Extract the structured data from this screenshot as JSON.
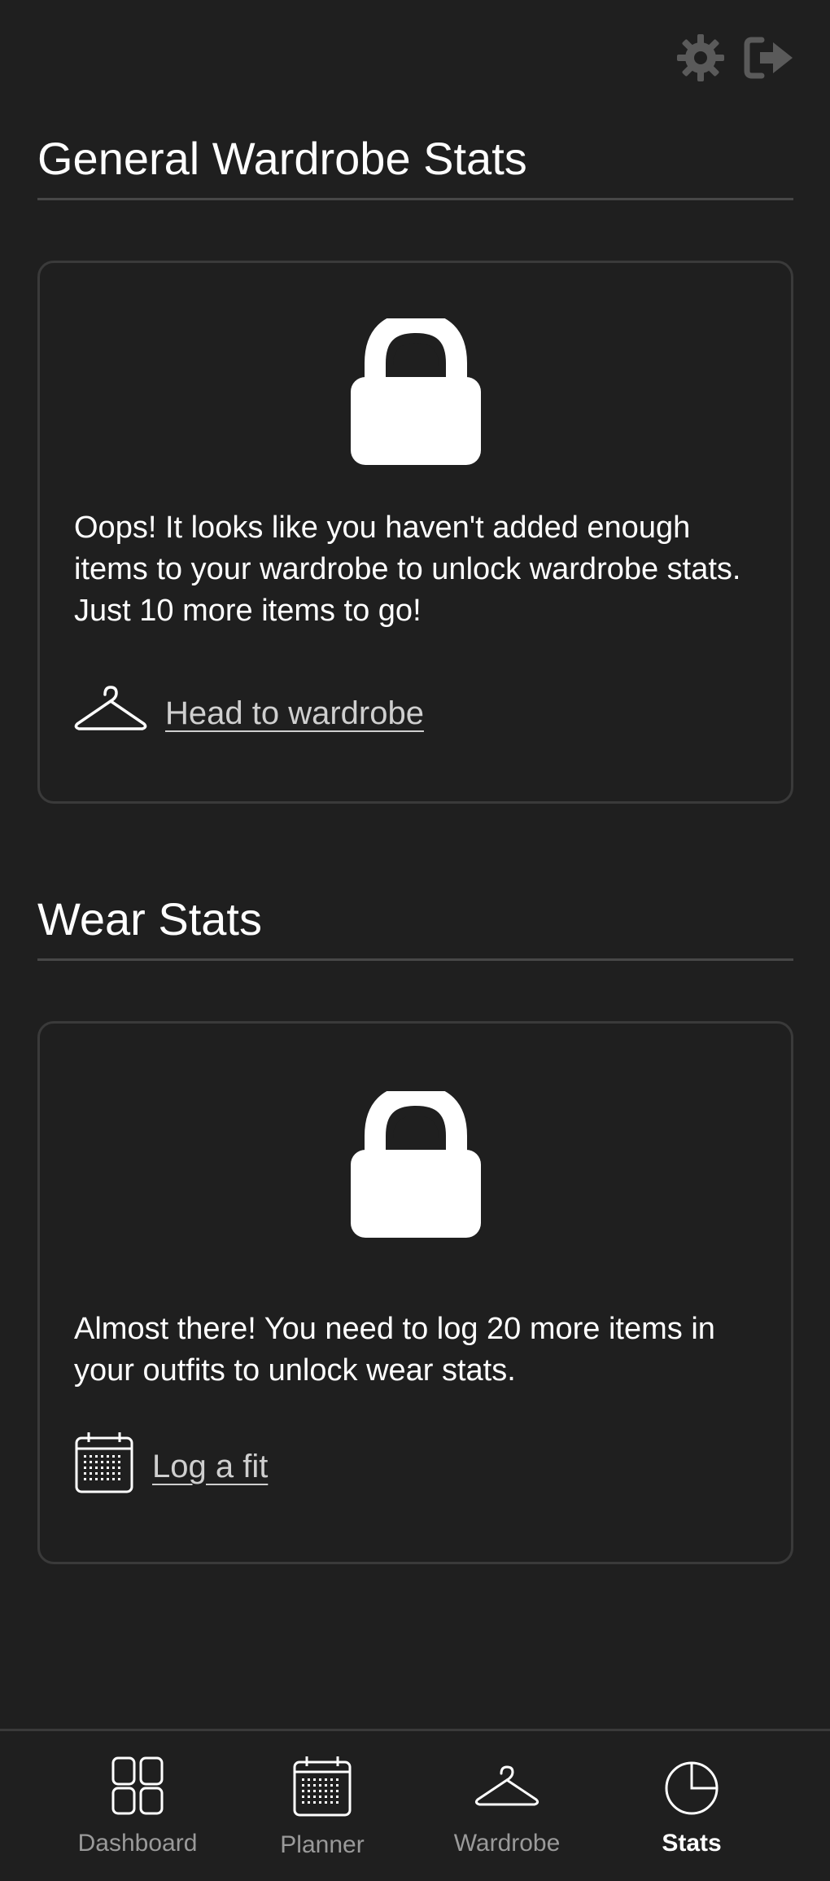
{
  "header": {
    "settings_icon": "gear-icon",
    "logout_icon": "logout-icon"
  },
  "sections": [
    {
      "title": "General Wardrobe Stats",
      "card": {
        "icon": "lock-icon",
        "message": "Oops! It looks like you haven't added enough items to your wardrobe to unlock wardrobe stats. Just 10 more items to go!",
        "link_icon": "hanger-icon",
        "link_label": "Head to wardrobe"
      }
    },
    {
      "title": "Wear Stats",
      "card": {
        "icon": "lock-icon",
        "message": "Almost there! You need to log 20 more items in your outfits to unlock wear stats.",
        "link_icon": "calendar-icon",
        "link_label": "Log a fit"
      }
    }
  ],
  "nav": {
    "items": [
      {
        "label": "Dashboard",
        "icon": "grid-icon",
        "active": false
      },
      {
        "label": "Planner",
        "icon": "calendar-icon",
        "active": false
      },
      {
        "label": "Wardrobe",
        "icon": "hanger-icon",
        "active": false
      },
      {
        "label": "Stats",
        "icon": "pie-chart-icon",
        "active": true
      }
    ]
  },
  "colors": {
    "background": "#1f1f1f",
    "text": "#ffffff",
    "muted": "#9a9a9a",
    "link": "#cfcfcf",
    "border": "#3a3a3a"
  }
}
